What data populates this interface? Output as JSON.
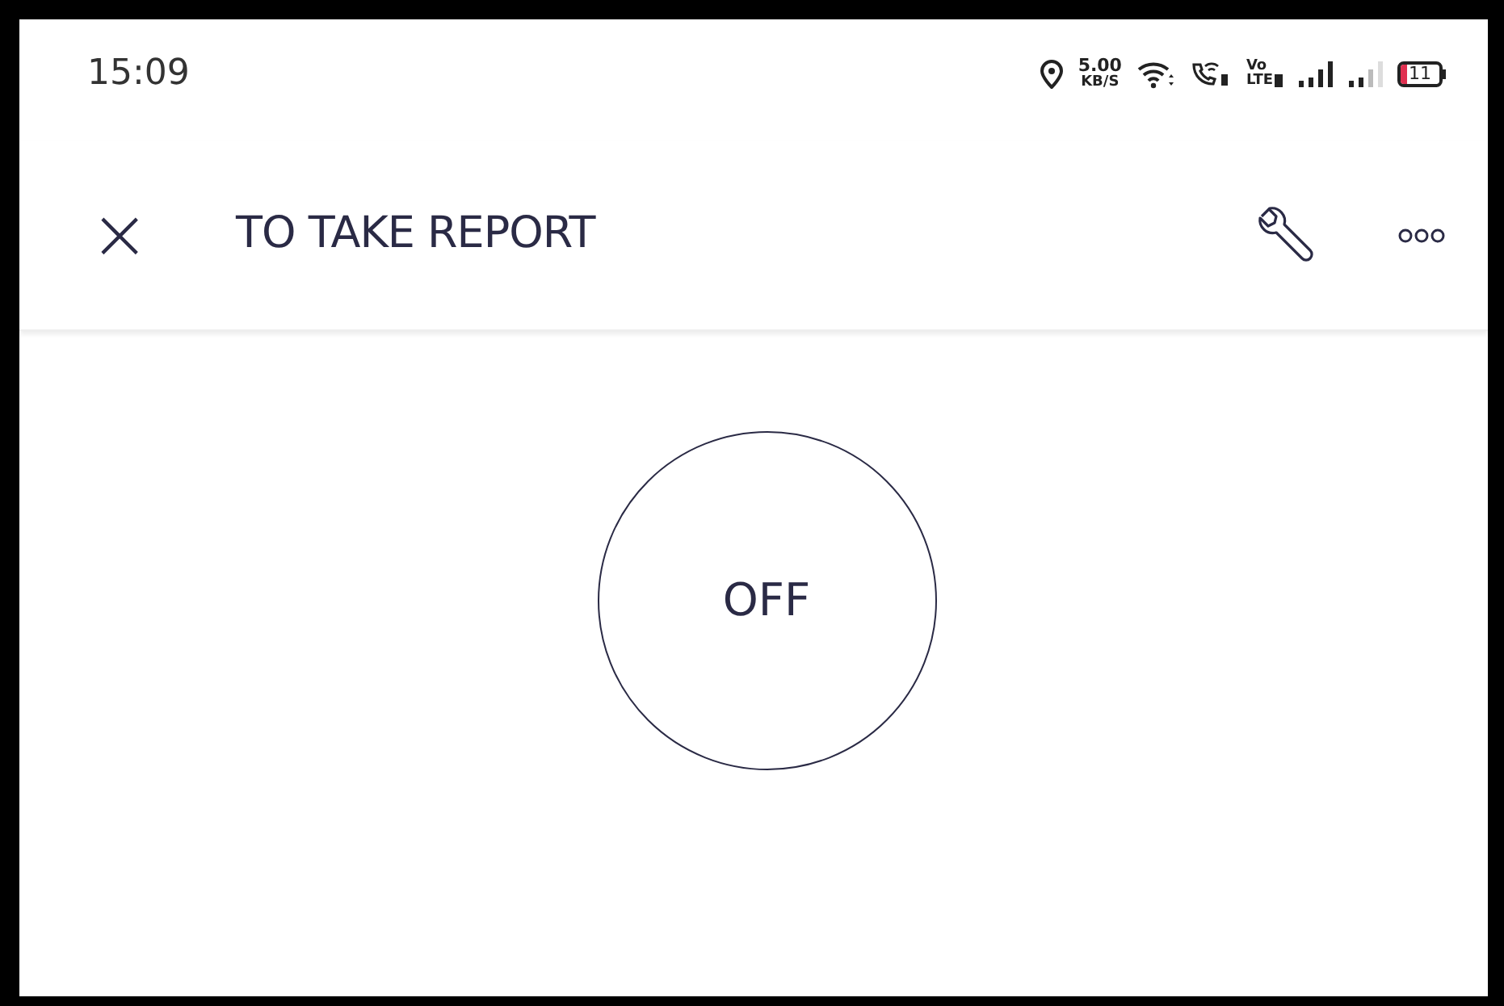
{
  "status_bar": {
    "time": "15:09",
    "speed_value": "5.00",
    "speed_unit": "KB/S",
    "volte_top": "Vo",
    "volte_bottom": "LTE",
    "battery": "11"
  },
  "app_bar": {
    "close": "×",
    "title": "TO TAKE REPORT"
  },
  "toggle": {
    "label": "OFF",
    "on": false
  }
}
